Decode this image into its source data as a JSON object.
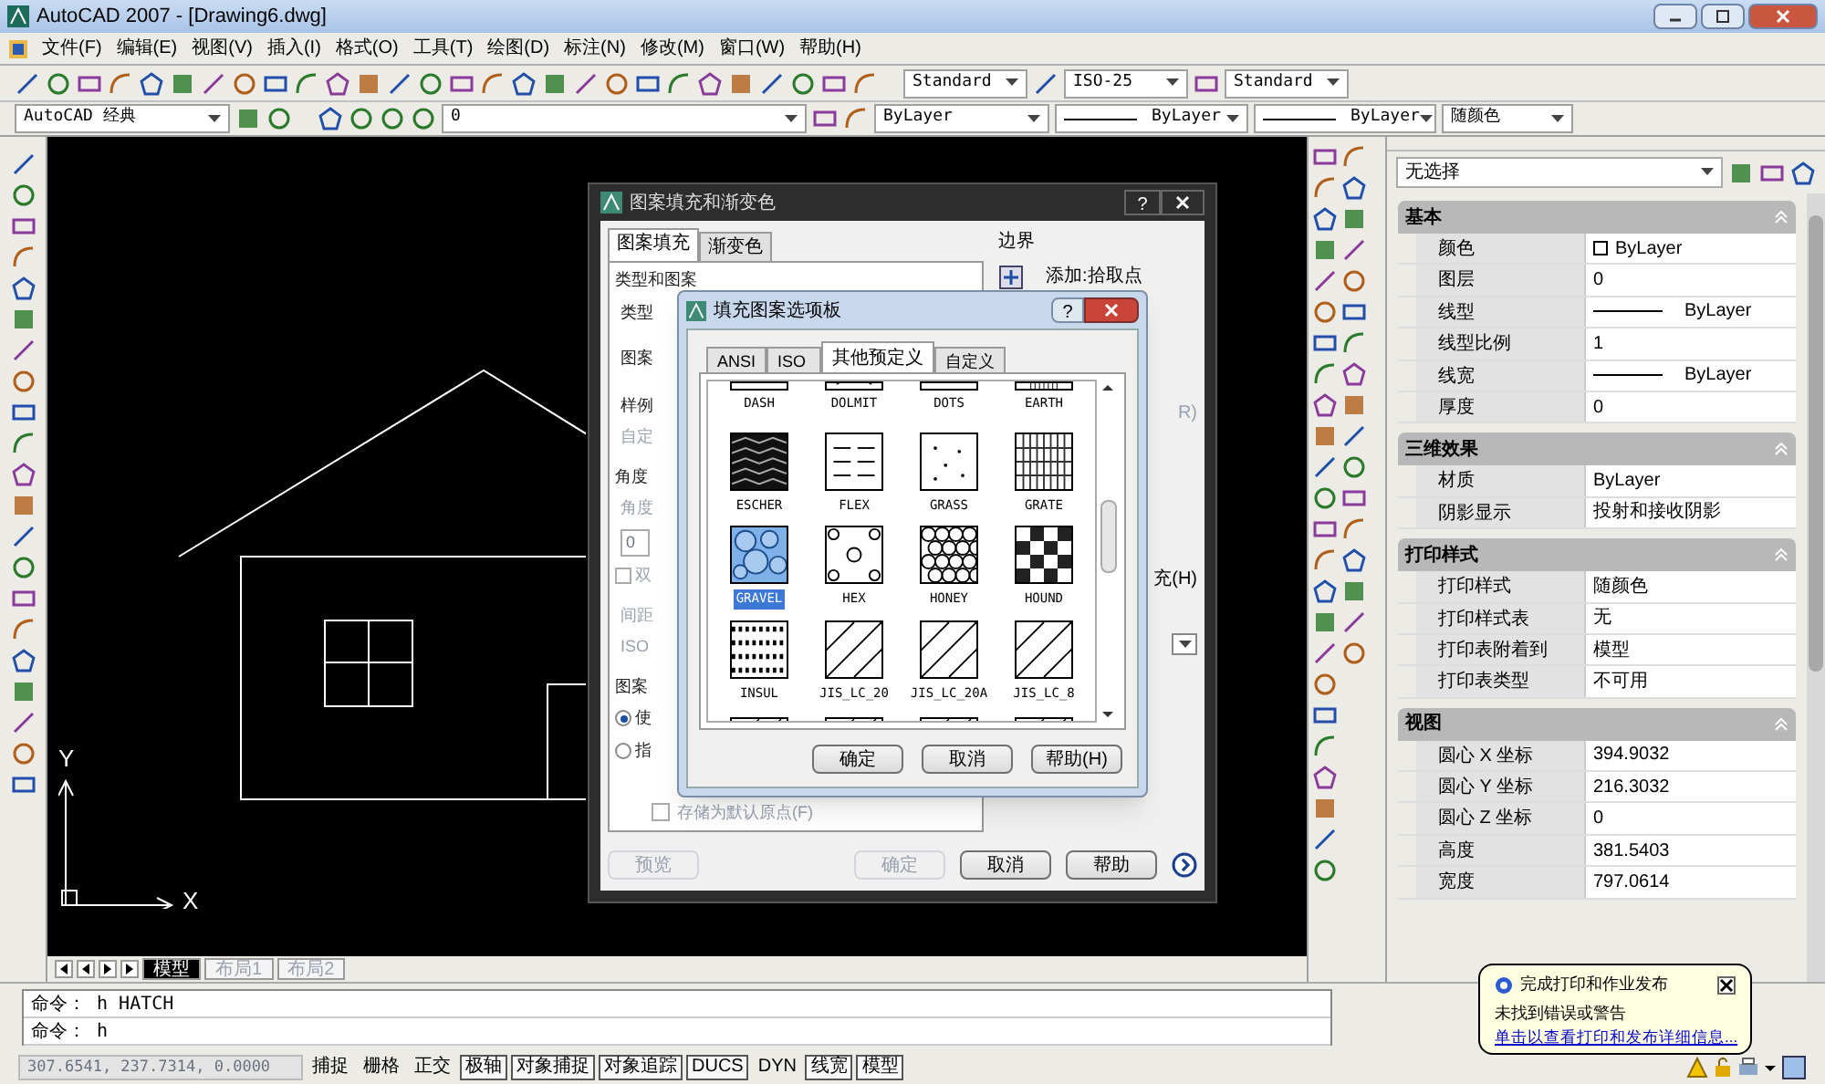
{
  "window": {
    "title": "AutoCAD 2007 - [Drawing6.dwg]"
  },
  "menu": [
    "文件(F)",
    "编辑(E)",
    "视图(V)",
    "插入(I)",
    "格式(O)",
    "工具(T)",
    "绘图(D)",
    "标注(N)",
    "修改(M)",
    "窗口(W)",
    "帮助(H)"
  ],
  "toolbar": {
    "text_style": "Standard",
    "dim_style": "ISO-25",
    "table_style": "Standard",
    "workspace": "AutoCAD 经典",
    "layer": "0",
    "color_control": "ByLayer",
    "linetype": "ByLayer",
    "lineweight": "ByLayer",
    "plot_style": "随颜色"
  },
  "canvas": {
    "ucs_y": "Y",
    "ucs_x": "X",
    "layout_tabs": [
      {
        "label": "模型",
        "selected": true
      },
      {
        "label": "布局1",
        "selected": false
      },
      {
        "label": "布局2",
        "selected": false
      }
    ]
  },
  "hatch_dialog": {
    "title": "图案填充和渐变色",
    "help": "?",
    "tabs": [
      {
        "label": "图案填充",
        "selected": true
      },
      {
        "label": "渐变色",
        "selected": false
      }
    ],
    "group_type": "类型和图案",
    "type_label": "类型",
    "pattern_label": "图案",
    "sample_label": "样例",
    "custom_label": "自定",
    "group_angle": "角度",
    "angle_label": "角度",
    "angle_value": "0",
    "double": {
      "label": "双",
      "checked": false
    },
    "spacing_label": "间距",
    "iso_label": "ISO",
    "group_origin": "图案",
    "origin_options": [
      {
        "label": "使",
        "selected": true
      },
      {
        "label": "指",
        "selected": false
      }
    ],
    "store_origin": {
      "label": "存储为默认原点(F)",
      "checked": false
    },
    "boundary_title": "边界",
    "add_pick": "添加:拾取点",
    "remove_fragment": "R)",
    "fill_fragment": "充(H)",
    "buttons": [
      {
        "label": "预览",
        "disabled": true
      },
      {
        "label": "确定",
        "disabled": true
      },
      {
        "label": "取消",
        "disabled": false
      },
      {
        "label": "帮助",
        "disabled": false
      }
    ]
  },
  "palette": {
    "title": "填充图案选项板",
    "help": "?",
    "tabs": [
      {
        "label": "ANSI",
        "selected": false
      },
      {
        "label": "ISO",
        "selected": false
      },
      {
        "label": "其他预定义",
        "selected": true
      },
      {
        "label": "自定义",
        "selected": false
      }
    ],
    "top_row": [
      {
        "name": "DASH",
        "kind": "dash"
      },
      {
        "name": "DOLMIT",
        "kind": "dolmit"
      },
      {
        "name": "DOTS",
        "kind": "dots"
      },
      {
        "name": "EARTH",
        "kind": "grid"
      }
    ],
    "patterns": [
      {
        "name": "ESCHER",
        "kind": "dense",
        "selected": false
      },
      {
        "name": "FLEX",
        "kind": "flex",
        "selected": false
      },
      {
        "name": "GRASS",
        "kind": "dots",
        "selected": false
      },
      {
        "name": "GRATE",
        "kind": "grid",
        "selected": false
      },
      {
        "name": "GRAVEL",
        "kind": "stones",
        "selected": true
      },
      {
        "name": "HEX",
        "kind": "circles",
        "selected": false
      },
      {
        "name": "HONEY",
        "kind": "hex",
        "selected": false
      },
      {
        "name": "HOUND",
        "kind": "checker",
        "selected": false
      },
      {
        "name": "INSUL",
        "kind": "brick",
        "selected": false
      },
      {
        "name": "JIS_LC_20",
        "kind": "diagonal",
        "selected": false
      },
      {
        "name": "JIS_LC_20A",
        "kind": "diagonal",
        "selected": false
      },
      {
        "name": "JIS_LC_8",
        "kind": "diagonal",
        "selected": false
      }
    ],
    "bottom_row": [
      {
        "kind": "diagonal"
      },
      {
        "kind": "diagonal"
      },
      {
        "kind": "diagonal"
      },
      {
        "kind": "diagonal"
      }
    ],
    "buttons": [
      "确定",
      "取消",
      "帮助(H)"
    ]
  },
  "properties": {
    "selection": "无选择",
    "sections": [
      {
        "title": "基本",
        "rows": [
          {
            "label": "颜色",
            "value": "ByLayer",
            "kind": "color"
          },
          {
            "label": "图层",
            "value": "0",
            "kind": "text"
          },
          {
            "label": "线型",
            "value": "ByLayer",
            "kind": "line"
          },
          {
            "label": "线型比例",
            "value": "1",
            "kind": "text"
          },
          {
            "label": "线宽",
            "value": "ByLayer",
            "kind": "line"
          },
          {
            "label": "厚度",
            "value": "0",
            "kind": "text"
          }
        ]
      },
      {
        "title": "三维效果",
        "rows": [
          {
            "label": "材质",
            "value": "ByLayer",
            "kind": "text"
          },
          {
            "label": "阴影显示",
            "value": "投射和接收阴影",
            "kind": "text"
          }
        ]
      },
      {
        "title": "打印样式",
        "rows": [
          {
            "label": "打印样式",
            "value": "随颜色",
            "kind": "text"
          },
          {
            "label": "打印样式表",
            "value": "无",
            "kind": "text"
          },
          {
            "label": "打印表附着到",
            "value": "模型",
            "kind": "text"
          },
          {
            "label": "打印表类型",
            "value": "不可用",
            "kind": "text"
          }
        ]
      },
      {
        "title": "视图",
        "rows": [
          {
            "label": "圆心 X 坐标",
            "value": "394.9032",
            "kind": "text"
          },
          {
            "label": "圆心 Y 坐标",
            "value": "216.3032",
            "kind": "text"
          },
          {
            "label": "圆心 Z 坐标",
            "value": "0",
            "kind": "text"
          },
          {
            "label": "高度",
            "value": "381.5403",
            "kind": "text"
          },
          {
            "label": "宽度",
            "value": "797.0614",
            "kind": "text"
          }
        ]
      }
    ]
  },
  "balloon": {
    "title": "完成打印和作业发布",
    "message": "未找到错误或警告",
    "link": "单击以查看打印和发布详细信息..."
  },
  "command": {
    "lines": [
      "命令： h HATCH",
      "命令： h"
    ]
  },
  "status_bar": {
    "coordinates": "307.6541, 237.7314, 0.0000",
    "toggles": [
      {
        "label": "捕捉",
        "on": false
      },
      {
        "label": "栅格",
        "on": false
      },
      {
        "label": "正交",
        "on": false
      },
      {
        "label": "极轴",
        "on": true
      },
      {
        "label": "对象捕捉",
        "on": true
      },
      {
        "label": "对象追踪",
        "on": true
      },
      {
        "label": "DUCS",
        "on": true
      },
      {
        "label": "DYN",
        "on": false
      },
      {
        "label": "线宽",
        "on": true
      },
      {
        "label": "模型",
        "on": true
      }
    ]
  }
}
